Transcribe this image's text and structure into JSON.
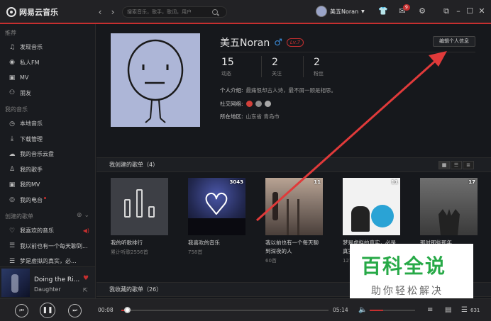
{
  "app": {
    "title": "网易云音乐"
  },
  "search": {
    "placeholder": "搜索音乐，歌手，歌词，用户"
  },
  "header": {
    "username": "美五Noran",
    "messages_badge": "9"
  },
  "sidebar": {
    "recommend_title": "推荐",
    "recommend_items": [
      {
        "label": "发现音乐",
        "icon": "music-note-icon"
      },
      {
        "label": "私人FM",
        "icon": "radio-icon"
      },
      {
        "label": "MV",
        "icon": "video-icon"
      },
      {
        "label": "朋友",
        "icon": "friends-icon"
      }
    ],
    "my_music_title": "我的音乐",
    "my_music_items": [
      {
        "label": "本地音乐",
        "icon": "clock-icon"
      },
      {
        "label": "下载管理",
        "icon": "download-icon"
      },
      {
        "label": "我的音乐云盘",
        "icon": "cloud-icon"
      },
      {
        "label": "我的歌手",
        "icon": "singer-icon"
      },
      {
        "label": "我的MV",
        "icon": "video-icon"
      },
      {
        "label": "我的电台",
        "icon": "podcast-icon"
      }
    ],
    "created_title": "创建的歌单",
    "created_items": [
      {
        "label": "我喜欢的音乐",
        "icon": "heart-icon"
      },
      {
        "label": "我以前也有一个每天聊到...",
        "icon": "playlist-icon"
      },
      {
        "label": "梦是虚拟的真实，必...",
        "icon": "playlist-icon"
      }
    ]
  },
  "now_playing": {
    "title": "Doing the Ri...",
    "artist": "Daughter"
  },
  "profile": {
    "name": "美五Noran",
    "level": "Lv.7",
    "edit_button": "编辑个人信息",
    "stats": [
      {
        "value": "15",
        "label": "动态"
      },
      {
        "value": "2",
        "label": "关注"
      },
      {
        "value": "2",
        "label": "粉丝"
      }
    ],
    "intro_label": "个人介绍:",
    "intro_value": "最痛恨却古人诗，最不屑一顾是相思。",
    "social_label": "社交网络:",
    "region_label": "所在地区:",
    "region_value": "山东省 青岛市"
  },
  "my_playlists": {
    "title": "我创建的歌单（4）",
    "cards": [
      {
        "title": "我的听歌排行",
        "sub": "累计听歌2556首",
        "count": ""
      },
      {
        "title": "我喜欢的音乐",
        "sub": "758首",
        "count": "3043"
      },
      {
        "title": "我以前也有一个每天聊到深夜的人",
        "sub": "60首",
        "count": "11"
      },
      {
        "title": "梦是虚拟的真实，必是真实的虚...",
        "sub": "12首",
        "count": "11"
      },
      {
        "title": "那时那些那年",
        "sub": "",
        "count": "17"
      }
    ]
  },
  "collected_playlists": {
    "title": "我收藏的歌单（26）"
  },
  "player": {
    "current_time": "00:08",
    "total_time": "05:14",
    "progress": 0.02,
    "volume": 0.3,
    "playlist_count": "631"
  },
  "watermark": {
    "title": "百科全说",
    "subtitle": "助你轻松解决"
  },
  "colors": {
    "accent": "#c62f2f",
    "background": "#16181c"
  }
}
